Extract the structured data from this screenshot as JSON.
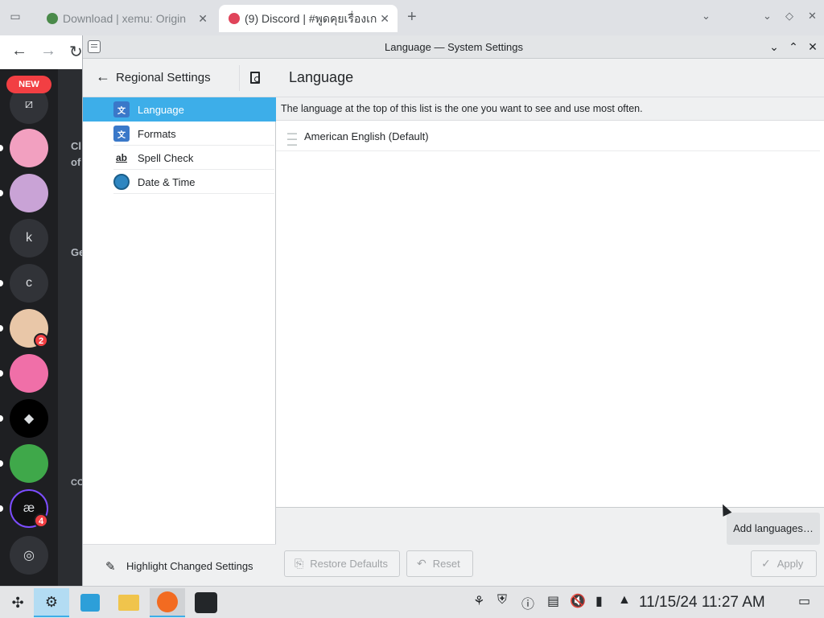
{
  "browser": {
    "tabs": [
      {
        "title": "Download | xemu: Origin",
        "state": "inactive"
      },
      {
        "title": "(9) Discord | #พูดคุยเรื่องเก",
        "state": "active"
      }
    ],
    "new_tab": "+"
  },
  "discord": {
    "new_label": "NEW",
    "servers": [
      {
        "label": "",
        "badge": ""
      },
      {
        "label": "",
        "badge": ""
      },
      {
        "label": "",
        "badge": ""
      },
      {
        "label": "k",
        "badge": ""
      },
      {
        "label": "c",
        "badge": ""
      },
      {
        "label": "",
        "badge": "2"
      },
      {
        "label": "",
        "badge": ""
      },
      {
        "label": "",
        "badge": ""
      },
      {
        "label": "",
        "badge": ""
      },
      {
        "label": "",
        "badge": "4"
      }
    ],
    "channel_fragments": [
      "Cl",
      "of",
      "Ge",
      "CO"
    ]
  },
  "window": {
    "title": "Language — System Settings"
  },
  "sidebar": {
    "title": "Regional Settings",
    "items": [
      {
        "label": "Language",
        "selected": true
      },
      {
        "label": "Formats",
        "selected": false
      },
      {
        "label": "Spell Check",
        "selected": false
      },
      {
        "label": "Date & Time",
        "selected": false
      }
    ],
    "footer": "Highlight Changed Settings"
  },
  "main": {
    "title": "Language",
    "description": "The language at the top of this list is the one you want to see and use most often.",
    "languages": [
      "American English (Default)"
    ],
    "add_button": "Add languages…",
    "restore_button": "Restore Defaults",
    "reset_button": "Reset",
    "apply_button": "Apply"
  },
  "taskbar": {
    "clock": "11/15/24 11:27 AM"
  },
  "colors": {
    "accent": "#3daee9",
    "discord_bg": "#1e1f22",
    "badge_red": "#f23f43"
  }
}
